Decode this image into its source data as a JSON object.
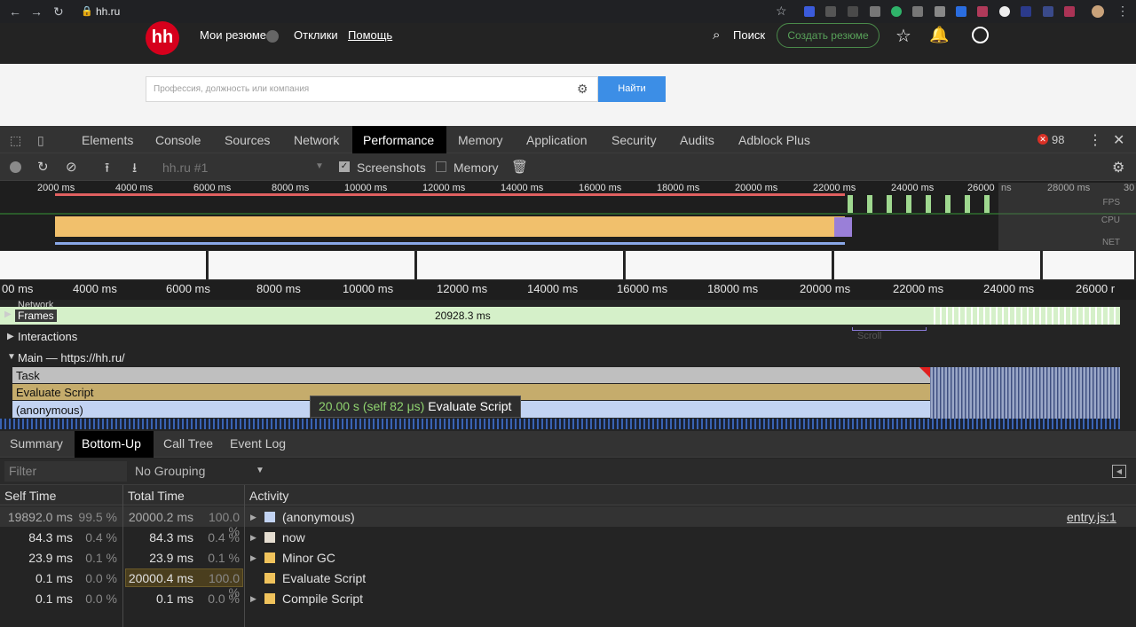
{
  "browser": {
    "url": "hh.ru"
  },
  "site": {
    "logo": "hh",
    "nav": [
      "Мои резюме",
      "Отклики",
      "Помощь"
    ],
    "search_link": "Поиск",
    "create_resume": "Создать резюме",
    "search_placeholder": "Профессия, должность или компания",
    "find_button": "Найти"
  },
  "devtools": {
    "tabs": [
      "Elements",
      "Console",
      "Sources",
      "Network",
      "Performance",
      "Memory",
      "Application",
      "Security",
      "Audits",
      "Adblock Plus"
    ],
    "active_tab": "Performance",
    "error_count": "98",
    "toolbar": {
      "profile": "hh.ru #1",
      "screenshots_label": "Screenshots",
      "memory_label": "Memory"
    },
    "overview": {
      "ticks": [
        "2000 ms",
        "4000 ms",
        "6000 ms",
        "8000 ms",
        "10000 ms",
        "12000 ms",
        "14000 ms",
        "16000 ms",
        "18000 ms",
        "20000 ms",
        "22000 ms",
        "24000 ms",
        "26000",
        "ns",
        "28000 ms",
        "30"
      ],
      "labels": [
        "FPS",
        "CPU",
        "NET"
      ]
    },
    "ruler_ticks": [
      "00 ms",
      "4000 ms",
      "6000 ms",
      "8000 ms",
      "10000 ms",
      "12000 ms",
      "14000 ms",
      "16000 ms",
      "18000 ms",
      "20000 ms",
      "22000 ms",
      "24000 ms",
      "26000 r"
    ],
    "tracks": {
      "network": "Network",
      "frames": "Frames",
      "frames_value": "20928.3 ms",
      "interactions": "Interactions",
      "scroll": "Scroll",
      "main": "Main — https://hh.ru/",
      "bars": [
        "Task",
        "Evaluate Script",
        "(anonymous)"
      ]
    },
    "tooltip": {
      "time": "20.00 s (self 82 μs)",
      "name": "Evaluate Script"
    },
    "bottom_tabs": [
      "Summary",
      "Bottom-Up",
      "Call Tree",
      "Event Log"
    ],
    "active_bottom_tab": "Bottom-Up",
    "filter_placeholder": "Filter",
    "grouping": "No Grouping",
    "columns": [
      "Self Time",
      "Total Time",
      "Activity"
    ],
    "rows": [
      {
        "self": "19892.0 ms",
        "self_pct": "99.5 %",
        "total": "20000.2 ms",
        "total_pct": "100.0 %",
        "activity": "(anonymous)",
        "color": "#c2d3f2",
        "link": "entry.js:1",
        "expandable": true
      },
      {
        "self": "84.3 ms",
        "self_pct": "0.4 %",
        "total": "84.3 ms",
        "total_pct": "0.4 %",
        "activity": "now",
        "color": "#e5ddd0",
        "link": "",
        "expandable": true
      },
      {
        "self": "23.9 ms",
        "self_pct": "0.1 %",
        "total": "23.9 ms",
        "total_pct": "0.1 %",
        "activity": "Minor GC",
        "color": "#f0c35c",
        "link": "",
        "expandable": true
      },
      {
        "self": "0.1 ms",
        "self_pct": "0.0 %",
        "total": "20000.4 ms",
        "total_pct": "100.0 %",
        "activity": "Evaluate Script",
        "color": "#f0c35c",
        "link": "",
        "expandable": false
      },
      {
        "self": "0.1 ms",
        "self_pct": "0.0 %",
        "total": "0.1 ms",
        "total_pct": "0.0 %",
        "activity": "Compile Script",
        "color": "#f0c35c",
        "link": "",
        "expandable": true
      }
    ]
  }
}
